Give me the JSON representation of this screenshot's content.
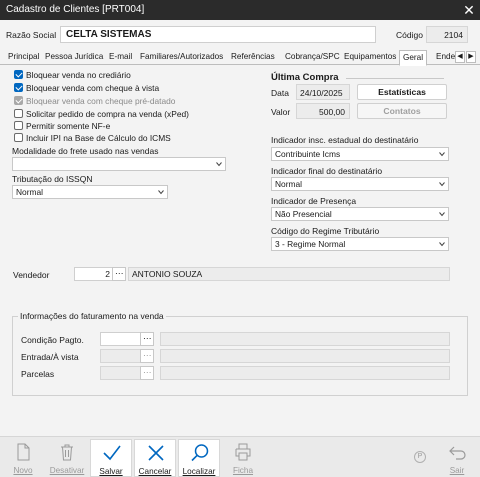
{
  "window": {
    "title": "Cadastro de Clientes [PRT004]"
  },
  "header": {
    "razao_label": "Razão Social",
    "razao_value": "CELTA SISTEMAS",
    "codigo_label": "Código",
    "codigo_value": "2104"
  },
  "tabs": [
    "Principal",
    "Pessoa Jurídica",
    "E-mail",
    "Familiares/Autorizados",
    "Referências",
    "Cobrança/SPC",
    "Equipamentos",
    "Geral",
    "Ende"
  ],
  "active_tab": "Geral",
  "checkboxes": [
    {
      "label": "Bloquear venda no crediário",
      "checked": true,
      "disabled": false
    },
    {
      "label": "Bloquear venda com cheque à vista",
      "checked": true,
      "disabled": false
    },
    {
      "label": "Bloquear venda com cheque pré-datado",
      "checked": true,
      "disabled": true
    },
    {
      "label": "Solicitar pedido de compra na venda (xPed)",
      "checked": false,
      "disabled": false
    },
    {
      "label": "Permitir somente NF-e",
      "checked": false,
      "disabled": false
    },
    {
      "label": "Incluir IPI na Base de Cálculo do ICMS",
      "checked": false,
      "disabled": false
    }
  ],
  "frete": {
    "label": "Modalidade do frete usado nas vendas",
    "value": ""
  },
  "issqn": {
    "label": "Tributação do ISSQN",
    "value": "Normal"
  },
  "ultima_compra": {
    "title": "Última Compra",
    "data_label": "Data",
    "data_value": "24/10/2025",
    "valor_label": "Valor",
    "valor_value": "500,00",
    "estatisticas_label": "Estatísticas",
    "contatos_label": "Contatos"
  },
  "right_selects": [
    {
      "label": "Indicador insc. estadual do destinatário",
      "value": "Contribuinte Icms"
    },
    {
      "label": "Indicador final do destinatário",
      "value": "Normal"
    },
    {
      "label": "Indicador de Presença",
      "value": "Não Presencial"
    },
    {
      "label": "Código do Regime Tributário",
      "value": "3 - Regime Normal"
    }
  ],
  "vendedor": {
    "label": "Vendedor",
    "code": "2",
    "name": "ANTONIO SOUZA"
  },
  "faturamento": {
    "title": "Informações do faturamento na venda",
    "rows": [
      {
        "label": "Condição Pagto.",
        "value": "",
        "enabled": true
      },
      {
        "label": "Entrada/À vista",
        "value": "",
        "enabled": false
      },
      {
        "label": "Parcelas",
        "value": "",
        "enabled": false
      }
    ]
  },
  "toolbar": {
    "novo": "Novo",
    "desativar": "Desativar",
    "salvar": "Salvar",
    "cancelar": "Cancelar",
    "localizar": "Localizar",
    "ficha": "Ficha",
    "sair": "Sair"
  },
  "colors": {
    "titlebar": "#2b2b2b",
    "accent": "#0067c0",
    "background": "#f3f3f3"
  }
}
